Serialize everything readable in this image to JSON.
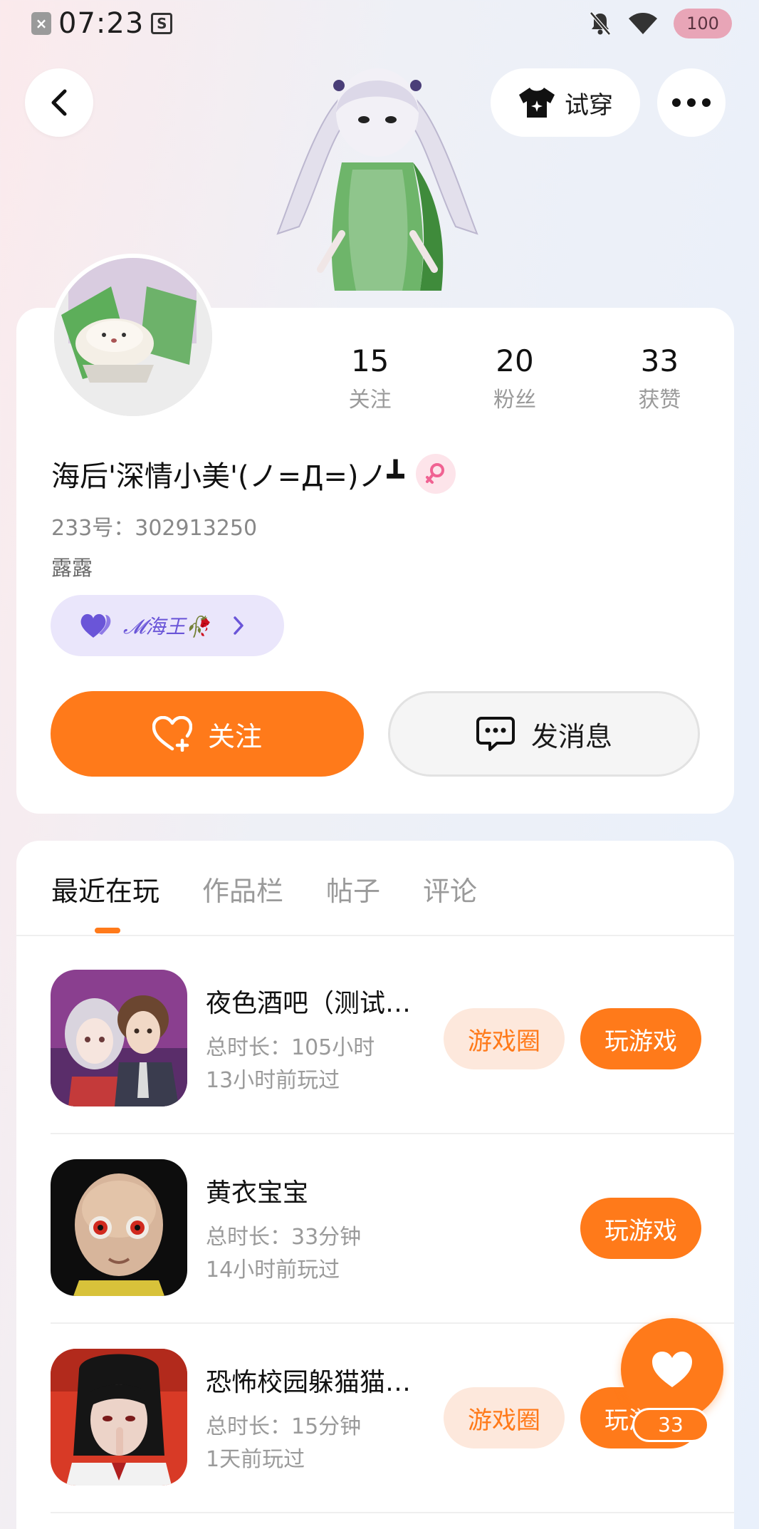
{
  "status_bar": {
    "time": "07:23",
    "battery": "100",
    "icons": [
      "close-notification-icon",
      "s-app-icon",
      "mute-bell-icon",
      "wifi-icon"
    ]
  },
  "header": {
    "try_on_label": "试穿"
  },
  "profile": {
    "stats": [
      {
        "value": "15",
        "label": "关注"
      },
      {
        "value": "20",
        "label": "粉丝"
      },
      {
        "value": "33",
        "label": "获赞"
      }
    ],
    "name": "海后'深情小美'(ノ=Д=)ノ┻",
    "uid": "233号：302913250",
    "bio": "露露",
    "badge_text": "𝓜海王🥀",
    "follow_label": "关注",
    "message_label": "发消息"
  },
  "tabs": [
    {
      "label": "最近在玩",
      "active": true
    },
    {
      "label": "作品栏",
      "active": false
    },
    {
      "label": "帖子",
      "active": false
    },
    {
      "label": "评论",
      "active": false
    }
  ],
  "games": [
    {
      "title": "夜色酒吧（测试…",
      "duration": "总时长：105小时",
      "last_played": "13小时前玩过",
      "circle_label": "游戏圈",
      "play_label": "玩游戏"
    },
    {
      "title": "黄衣宝宝",
      "duration": "总时长：33分钟",
      "last_played": "14小时前玩过",
      "circle_label": "",
      "play_label": "玩游戏"
    },
    {
      "title": "恐怖校园躲猫猫…",
      "duration": "总时长：15分钟",
      "last_played": "1天前玩过",
      "circle_label": "游戏圈",
      "play_label": "玩游戏"
    }
  ],
  "like_fab": {
    "count": "33"
  },
  "colors": {
    "accent": "#ff7a1a",
    "badge_bg": "#eae6fb",
    "badge_text": "#6a55d8"
  }
}
